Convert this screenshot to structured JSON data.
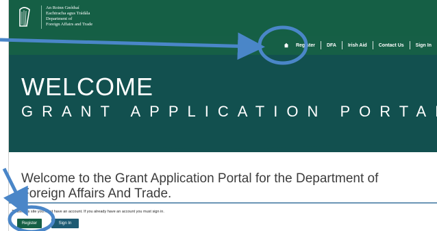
{
  "header": {
    "org_lines": [
      "An Roinn Gnóthaí",
      "Eachtracha agus Trádála",
      "Department of",
      "Foreign Affairs and Trade"
    ]
  },
  "nav": {
    "home_icon": "home-icon",
    "links": [
      "Register",
      "DFA",
      "Irish Aid",
      "Contact Us",
      "Sign In"
    ]
  },
  "hero": {
    "title": "WELCOME",
    "subtitle": "GRANT APPLICATION PORTAL"
  },
  "main": {
    "intro": "Welcome to the Grant Application Portal for the Department of Foreign Affairs And Trade.",
    "note": "To use this site you must have an account. If you already have an account you must sign in.",
    "register_button": "Register",
    "signin_button": "Sign In"
  },
  "colors": {
    "header_green": "#155f45",
    "hero_teal": "#12504f",
    "annotation_blue": "#4a86c8"
  }
}
